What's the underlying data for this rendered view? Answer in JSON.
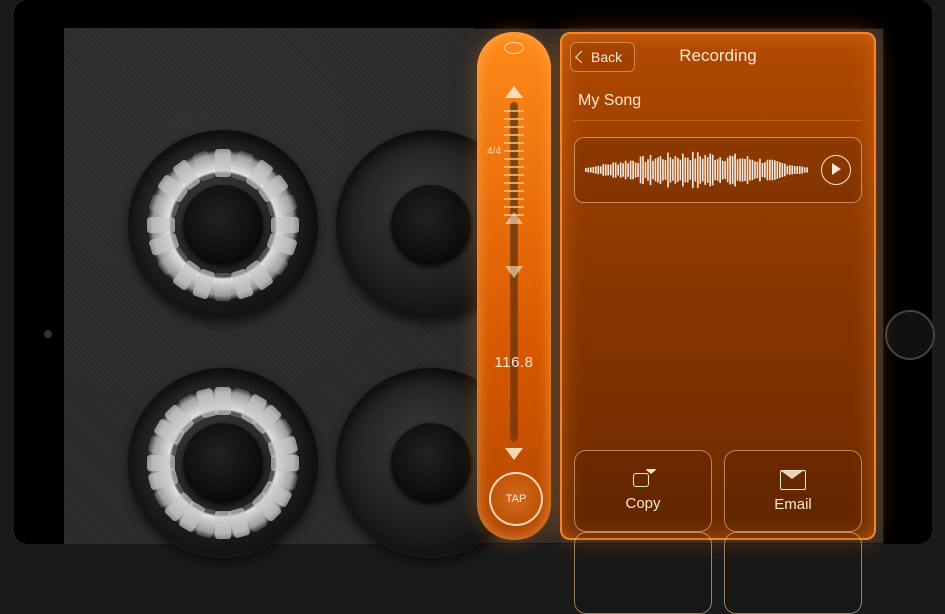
{
  "tempo": {
    "time_signature": "4/4",
    "bpm": "116.8",
    "tap_label": "TAP"
  },
  "recording_panel": {
    "back_label": "Back",
    "title": "Recording",
    "song_name": "My Song",
    "actions": {
      "copy": "Copy",
      "email": "Email"
    }
  }
}
